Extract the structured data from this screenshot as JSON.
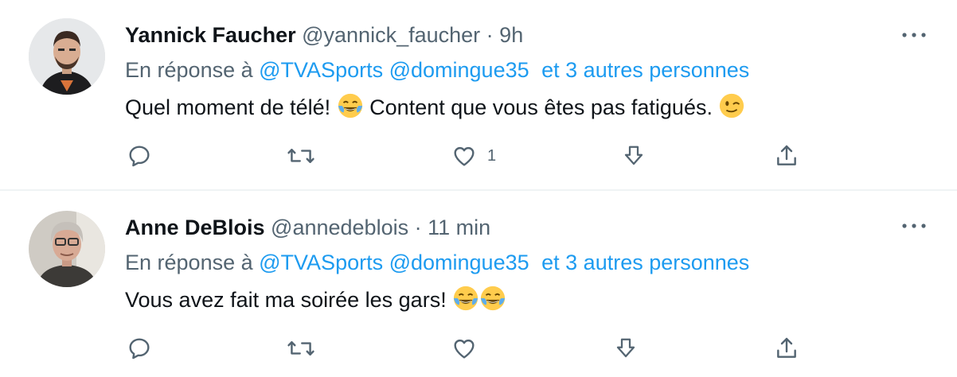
{
  "tweets": [
    {
      "name": "Yannick Faucher",
      "handle": "@yannick_faucher",
      "separator": "·",
      "time": "9h",
      "reply_prefix": "En réponse à",
      "reply_mentions": "@TVASports @domingue35",
      "reply_others": "et 3 autres personnes",
      "text_part1": "Quel moment de télé!",
      "text_part2": "Content que vous êtes pas fatigués.",
      "like_count": "1",
      "emojis": [
        "tears-of-joy-emoji",
        "winking-face-emoji"
      ]
    },
    {
      "name": "Anne DeBlois",
      "handle": "@annedeblois",
      "separator": "·",
      "time": "11 min",
      "reply_prefix": "En réponse à",
      "reply_mentions": "@TVASports @domingue35",
      "reply_others": "et 3 autres personnes",
      "text_part1": "Vous avez fait ma soirée les gars!",
      "like_count": "",
      "emojis": [
        "tears-of-joy-emoji",
        "tears-of-joy-emoji"
      ]
    }
  ],
  "colors": {
    "text": "#0f1419",
    "secondary": "#536471",
    "link": "#1d9bf0",
    "divider": "#eff3f4"
  }
}
